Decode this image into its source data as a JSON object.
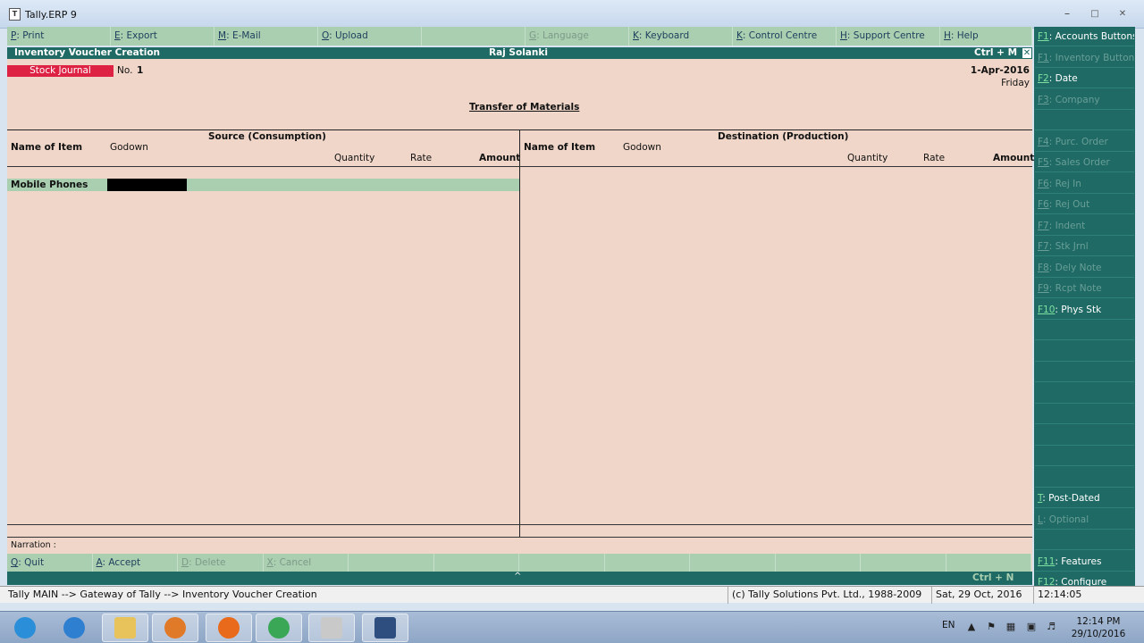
{
  "window": {
    "title": "Tally.ERP 9"
  },
  "topbar": [
    {
      "key": "P",
      "label": ": Print",
      "disabled": false
    },
    {
      "key": "E",
      "label": ": Export",
      "disabled": false
    },
    {
      "key": "M",
      "label": ": E-Mail",
      "disabled": false
    },
    {
      "key": "O",
      "label": ": Upload",
      "disabled": false
    },
    {
      "key": "",
      "label": "",
      "disabled": true
    },
    {
      "key": "G",
      "label": ": Language",
      "disabled": true
    },
    {
      "key": "K",
      "label": ": Keyboard",
      "disabled": false
    },
    {
      "key": "K",
      "label": ": Control Centre",
      "disabled": false
    },
    {
      "key": "H",
      "label": ": Support Centre",
      "disabled": false
    },
    {
      "key": "H",
      "label": ": Help",
      "disabled": false
    }
  ],
  "header": {
    "screen_title": "Inventory Voucher  Creation",
    "company": "Raj Solanki",
    "shortcut": "Ctrl + M",
    "close": "✕"
  },
  "voucher": {
    "type": "Stock Journal",
    "no_label": "No.",
    "no_value": "1",
    "date": "1-Apr-2016",
    "day": "Friday",
    "title": "Transfer of Materials"
  },
  "source": {
    "heading": "Source (Consumption)",
    "name_of_item": "Name of Item",
    "godown": "Godown",
    "quantity": "Quantity",
    "rate": "Rate",
    "amount": "Amount",
    "rows": [
      {
        "item": "Mobile Phones"
      }
    ]
  },
  "destination": {
    "heading": "Destination (Production)",
    "name_of_item": "Name of Item",
    "godown": "Godown",
    "quantity": "Quantity",
    "rate": "Rate",
    "amount": "Amount"
  },
  "narration_label": "Narration :",
  "bottombar": [
    {
      "key": "Q",
      "label": ": Quit",
      "disabled": false
    },
    {
      "key": "A",
      "label": ": Accept",
      "disabled": false
    },
    {
      "key": "D",
      "label": ": Delete",
      "disabled": true
    },
    {
      "key": "X",
      "label": ": Cancel",
      "disabled": true
    },
    {
      "key": "",
      "label": "",
      "disabled": true
    },
    {
      "key": "",
      "label": "",
      "disabled": true
    },
    {
      "key": "",
      "label": "",
      "disabled": true
    },
    {
      "key": "",
      "label": "",
      "disabled": true
    },
    {
      "key": "",
      "label": "",
      "disabled": true
    },
    {
      "key": "",
      "label": "",
      "disabled": true
    },
    {
      "key": "",
      "label": "",
      "disabled": true
    },
    {
      "key": "",
      "label": "",
      "disabled": true
    }
  ],
  "ctrl_n": "Ctrl + N",
  "caret": "^",
  "sidebar": [
    {
      "key": "F1",
      "label": ": Accounts Buttons",
      "disabled": false
    },
    {
      "key": "F1",
      "label": ": Inventory Buttons",
      "disabled": true
    },
    {
      "key": "F2",
      "label": ": Date",
      "disabled": false
    },
    {
      "key": "F3",
      "label": ": Company",
      "disabled": true
    },
    {
      "key": "",
      "label": "",
      "disabled": true
    },
    {
      "key": "F4",
      "label": ": Purc. Order",
      "disabled": true
    },
    {
      "key": "F5",
      "label": ": Sales Order",
      "disabled": true
    },
    {
      "key": "F6",
      "label": ": Rej In",
      "disabled": true
    },
    {
      "key": "F6",
      "label": ": Rej Out",
      "disabled": true
    },
    {
      "key": "F7",
      "label": ": Indent",
      "disabled": true
    },
    {
      "key": "F7",
      "label": ": Stk Jrnl",
      "disabled": true
    },
    {
      "key": "F8",
      "label": ": Dely Note",
      "disabled": true
    },
    {
      "key": "F9",
      "label": ": Rcpt Note",
      "disabled": true
    },
    {
      "key": "F10",
      "label": ": Phys Stk",
      "disabled": false
    },
    {
      "key": "",
      "label": "",
      "disabled": true
    },
    {
      "key": "",
      "label": "",
      "disabled": true
    },
    {
      "key": "",
      "label": "",
      "disabled": true
    },
    {
      "key": "",
      "label": "",
      "disabled": true
    },
    {
      "key": "",
      "label": "",
      "disabled": true
    },
    {
      "key": "",
      "label": "",
      "disabled": true
    },
    {
      "key": "",
      "label": "",
      "disabled": true
    },
    {
      "key": "",
      "label": "",
      "disabled": true
    },
    {
      "key": "T",
      "label": ": Post-Dated",
      "disabled": false
    },
    {
      "key": "L",
      "label": ": Optional",
      "disabled": true
    },
    {
      "key": "",
      "label": "",
      "disabled": true
    },
    {
      "key": "F11",
      "label": ": Features",
      "disabled": false
    },
    {
      "key": "F12",
      "label": ": Configure",
      "disabled": false
    }
  ],
  "status": {
    "path": "Tally MAIN --> Gateway of Tally --> Inventory Voucher  Creation",
    "copyright": "(c) Tally Solutions Pvt. Ltd., 1988-2009",
    "date": "Sat, 29 Oct, 2016",
    "time": "12:14:05"
  },
  "taskbar": {
    "lang": "EN",
    "clock_time": "12:14 PM",
    "clock_date": "29/10/2016",
    "apps": [
      {
        "name": "start-button-icon",
        "color": "#2a8fd8"
      },
      {
        "name": "internet-explorer-icon",
        "color": "#2f7fd0"
      },
      {
        "name": "file-explorer-icon",
        "color": "#e8c25a"
      },
      {
        "name": "media-player-icon",
        "color": "#e07a28"
      },
      {
        "name": "firefox-icon",
        "color": "#e86a1a"
      },
      {
        "name": "chrome-icon",
        "color": "#3aa757"
      },
      {
        "name": "tally-app-icon",
        "color": "#c9c9c9"
      },
      {
        "name": "save-disk-icon",
        "color": "#2e4e80"
      }
    ]
  }
}
